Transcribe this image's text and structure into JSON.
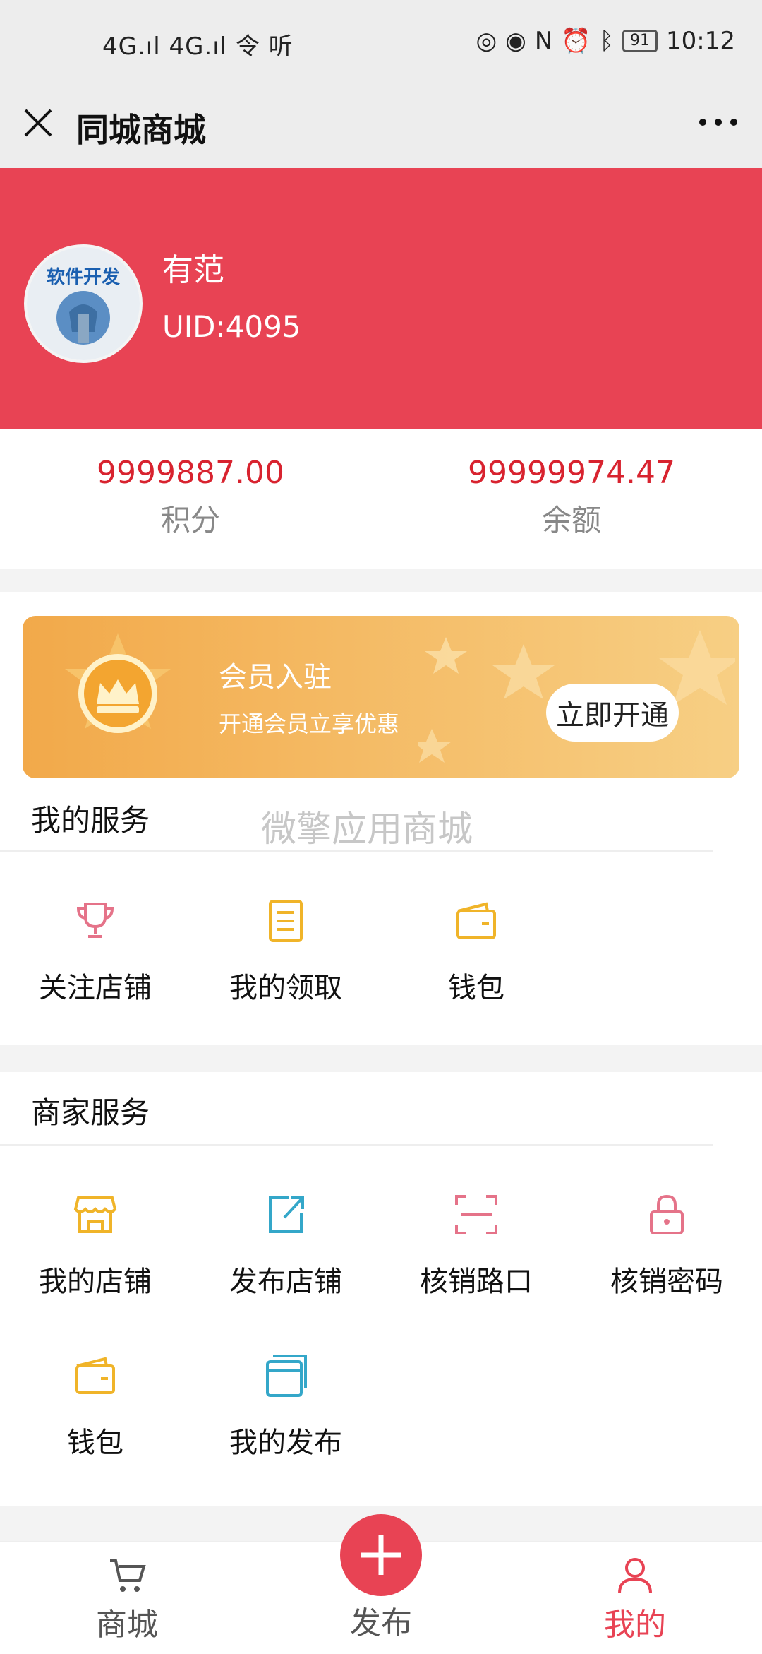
{
  "status": {
    "left": "4G.ıl 4G.ıl 令 听",
    "battery": "91",
    "time": "10:12"
  },
  "titlebar": {
    "title": "同城商城"
  },
  "profile": {
    "avatar_text": "软件开发",
    "name": "有范",
    "uid": "UID:4095"
  },
  "stats": [
    {
      "value": "9999887.00",
      "label": "积分"
    },
    {
      "value": "99999974.47",
      "label": "余额"
    }
  ],
  "banner": {
    "title": "会员入驻",
    "subtitle": "开通会员立享优惠",
    "button": "立即开通"
  },
  "watermark": "微擎应用商城",
  "my_services": {
    "title": "我的服务",
    "items": [
      {
        "label": "关注店铺",
        "icon": "trophy-icon"
      },
      {
        "label": "我的领取",
        "icon": "document-icon"
      },
      {
        "label": "钱包",
        "icon": "wallet-icon"
      }
    ]
  },
  "merchant_services": {
    "title": "商家服务",
    "items": [
      {
        "label": "我的店铺",
        "icon": "store-icon"
      },
      {
        "label": "发布店铺",
        "icon": "share-icon"
      },
      {
        "label": "核销路口",
        "icon": "scan-icon"
      },
      {
        "label": "核销密码",
        "icon": "lock-icon"
      },
      {
        "label": "钱包",
        "icon": "wallet-icon"
      },
      {
        "label": "我的发布",
        "icon": "window-icon"
      }
    ]
  },
  "nav": {
    "items": [
      {
        "label": "商城",
        "icon": "cart-icon"
      },
      {
        "label": "发布",
        "icon": "plus-icon"
      },
      {
        "label": "我的",
        "icon": "user-icon"
      }
    ]
  },
  "colors": {
    "brand": "#e84354",
    "value_red": "#d8232f",
    "banner_orange": "#f2a94a",
    "icon_yellow": "#f0b429",
    "icon_pink": "#e57389",
    "icon_blue": "#34a7c9"
  }
}
